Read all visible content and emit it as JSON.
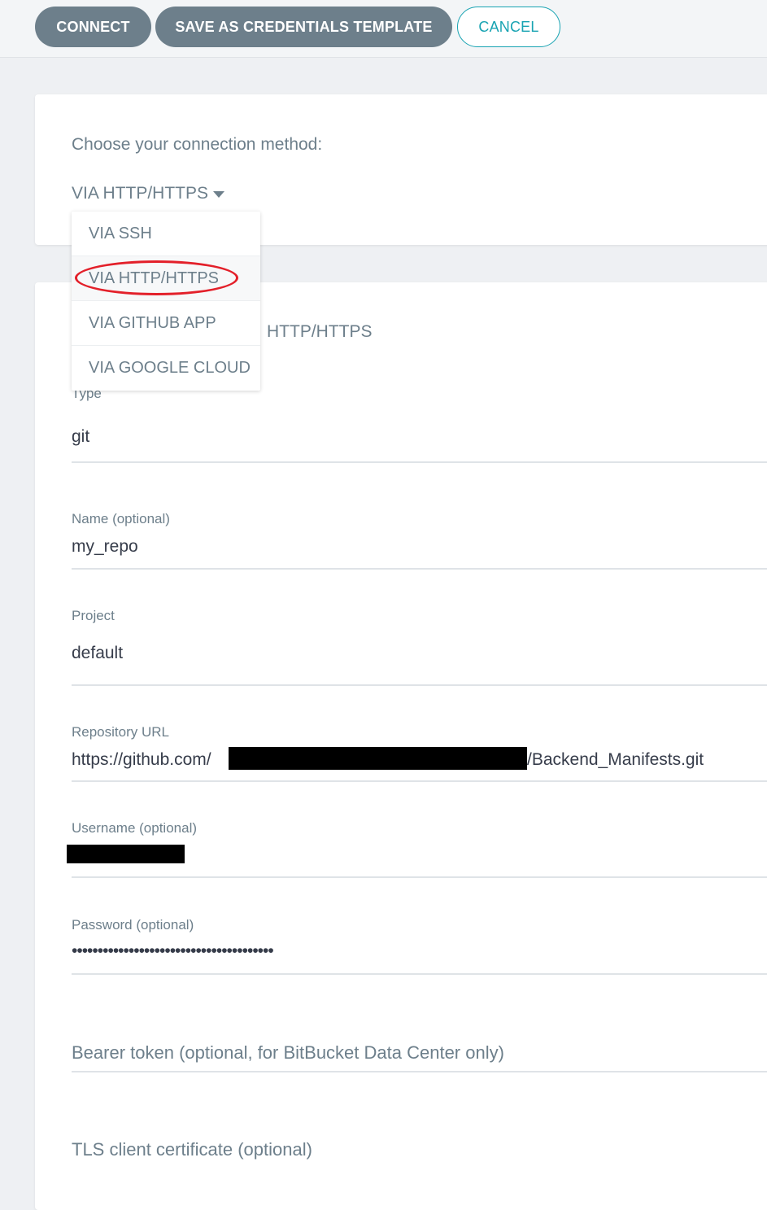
{
  "toolbar": {
    "connect_label": "CONNECT",
    "save_template_label": "SAVE AS CREDENTIALS TEMPLATE",
    "cancel_label": "CANCEL"
  },
  "connection": {
    "prompt": "Choose your connection method:",
    "selected": "VIA HTTP/HTTPS",
    "options": [
      "VIA SSH",
      "VIA HTTP/HTTPS",
      "VIA GITHUB APP",
      "VIA GOOGLE CLOUD"
    ],
    "section_title_visible_fragment": "HTTP/HTTPS"
  },
  "form": {
    "type": {
      "label": "Type",
      "value": "git"
    },
    "name": {
      "label": "Name (optional)",
      "value": "my_repo"
    },
    "project": {
      "label": "Project",
      "value": "default"
    },
    "repo_url": {
      "label": "Repository URL",
      "prefix": "https://github.com/",
      "suffix": "/Backend_Manifests.git"
    },
    "username": {
      "label": "Username (optional)"
    },
    "password": {
      "label": "Password (optional)",
      "masked": "•••••••••••••••••••••••••••••••••••••••"
    },
    "bearer_token": {
      "placeholder": "Bearer token (optional, for BitBucket Data Center only)"
    },
    "tls_cert": {
      "placeholder": "TLS client certificate (optional)"
    }
  },
  "colors": {
    "primary_button": "#6d7f8b",
    "accent": "#18a3b2",
    "highlight_ring": "#e3202a",
    "text": "#363c4a",
    "muted_text": "#6d7f8b"
  }
}
